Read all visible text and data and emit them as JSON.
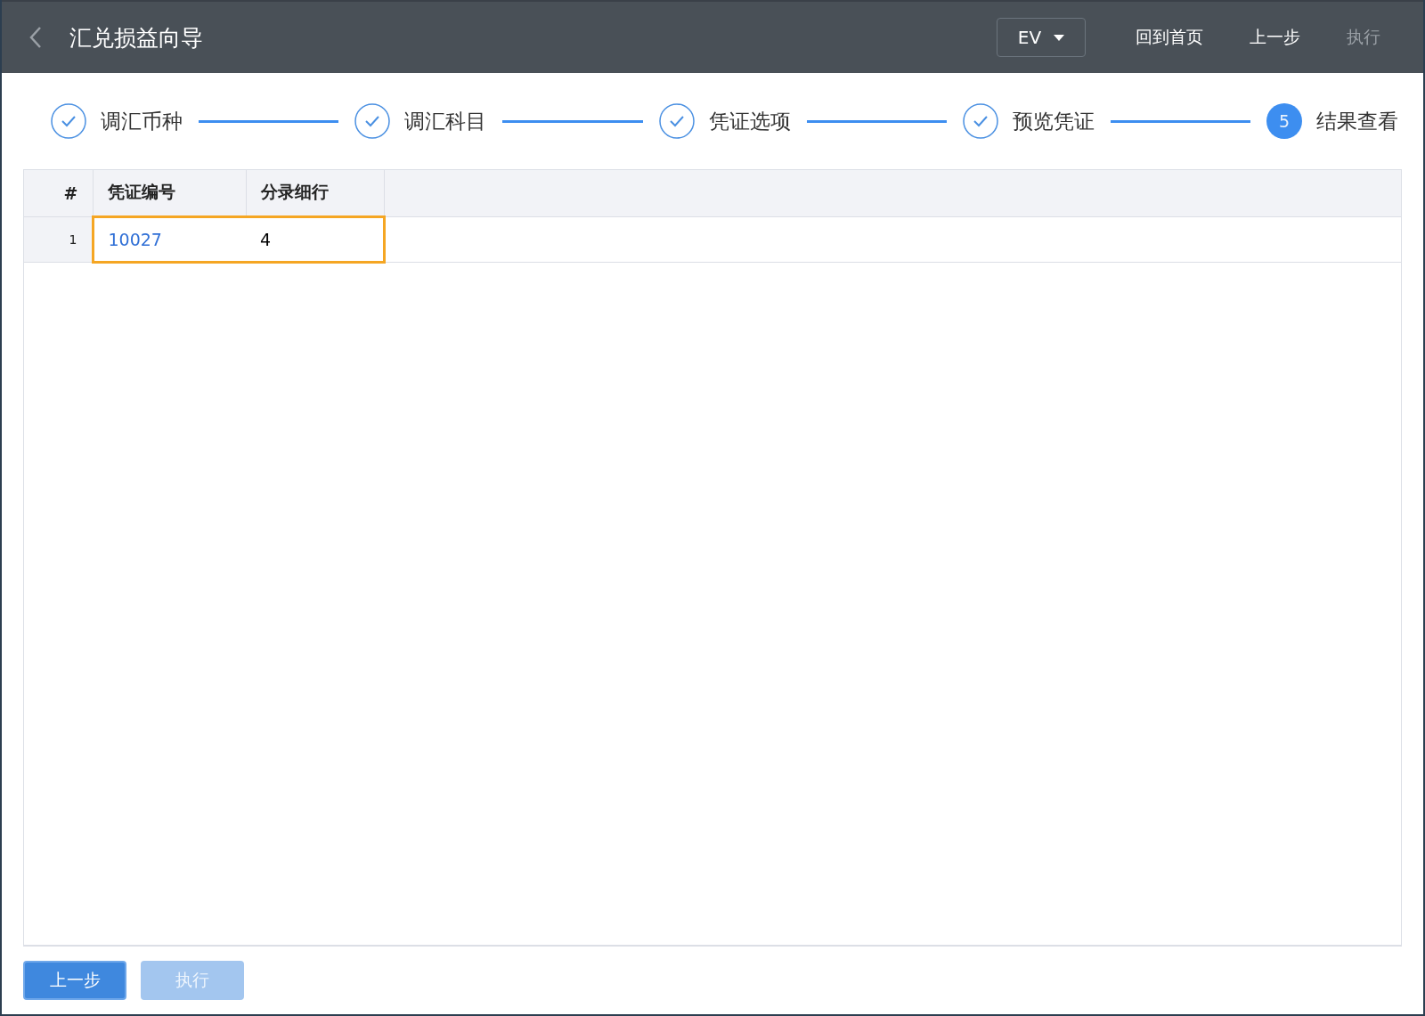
{
  "header": {
    "title": "汇兑损益向导",
    "currency": "EV",
    "actions": [
      {
        "label": "回到首页",
        "disabled": false
      },
      {
        "label": "上一步",
        "disabled": false
      },
      {
        "label": "执行",
        "disabled": true
      }
    ]
  },
  "steps": [
    {
      "label": "调汇币种",
      "kind": "done"
    },
    {
      "label": "调汇科目",
      "kind": "done"
    },
    {
      "label": "凭证选项",
      "kind": "done"
    },
    {
      "label": "预览凭证",
      "kind": "done"
    },
    {
      "label": "结果查看",
      "kind": "current",
      "number": "5"
    }
  ],
  "table": {
    "columns": [
      "#",
      "凭证编号",
      "分录细行"
    ],
    "rows": [
      {
        "index": "1",
        "voucher": "10027",
        "lines": "4",
        "selected": true
      }
    ]
  },
  "footer": {
    "buttons": [
      {
        "label": "上一步",
        "disabled": false
      },
      {
        "label": "执行",
        "disabled": true
      }
    ]
  }
}
